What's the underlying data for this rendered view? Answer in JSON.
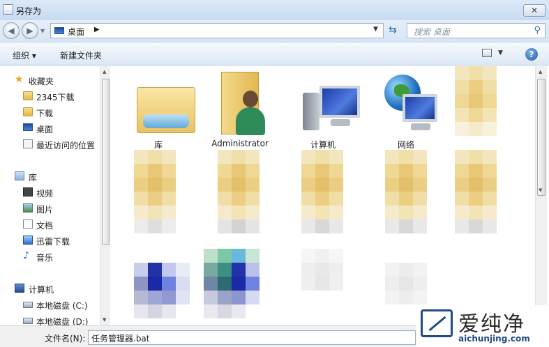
{
  "window": {
    "title": "另存为",
    "close_label": "✕"
  },
  "address": {
    "location": "桌面",
    "search_placeholder": "搜索 桌面"
  },
  "toolbar": {
    "organize_label": "组织 ▾",
    "new_folder_label": "新建文件夹",
    "help_label": "?"
  },
  "nav_pane": {
    "items": [
      {
        "label": "收藏夹",
        "icon": "star-icon"
      },
      {
        "label": "2345下载",
        "icon": "folder-icon"
      },
      {
        "label": "下载",
        "icon": "download-folder-icon"
      },
      {
        "label": "桌面",
        "icon": "desktop-icon"
      },
      {
        "label": "最近访问的位置",
        "icon": "recent-places-icon"
      },
      {
        "label": "库",
        "icon": "library-icon"
      },
      {
        "label": "视频",
        "icon": "video-icon"
      },
      {
        "label": "图片",
        "icon": "pictures-icon"
      },
      {
        "label": "文档",
        "icon": "documents-icon"
      },
      {
        "label": "迅雷下载",
        "icon": "thunder-download-icon"
      },
      {
        "label": "音乐",
        "icon": "music-icon"
      },
      {
        "label": "计算机",
        "icon": "computer-icon"
      },
      {
        "label": "本地磁盘 (C:)",
        "icon": "disk-icon"
      },
      {
        "label": "本地磁盘 (D:)",
        "icon": "disk-icon"
      }
    ]
  },
  "content": {
    "items": [
      {
        "label": "库",
        "icon": "library-folder-icon"
      },
      {
        "label": "Administrator",
        "icon": "user-folder-icon"
      },
      {
        "label": "计算机",
        "icon": "computer-icon"
      },
      {
        "label": "网络",
        "icon": "network-icon"
      }
    ]
  },
  "filename": {
    "label": "文件名(N):",
    "value": "任务管理器.bat"
  },
  "watermark": {
    "title": "爱纯净",
    "url": "aichunjing.com"
  },
  "colors": {
    "titlebar": "#c9dcf1",
    "toolbar": "#dde8f5",
    "accent": "#1f4b86"
  }
}
